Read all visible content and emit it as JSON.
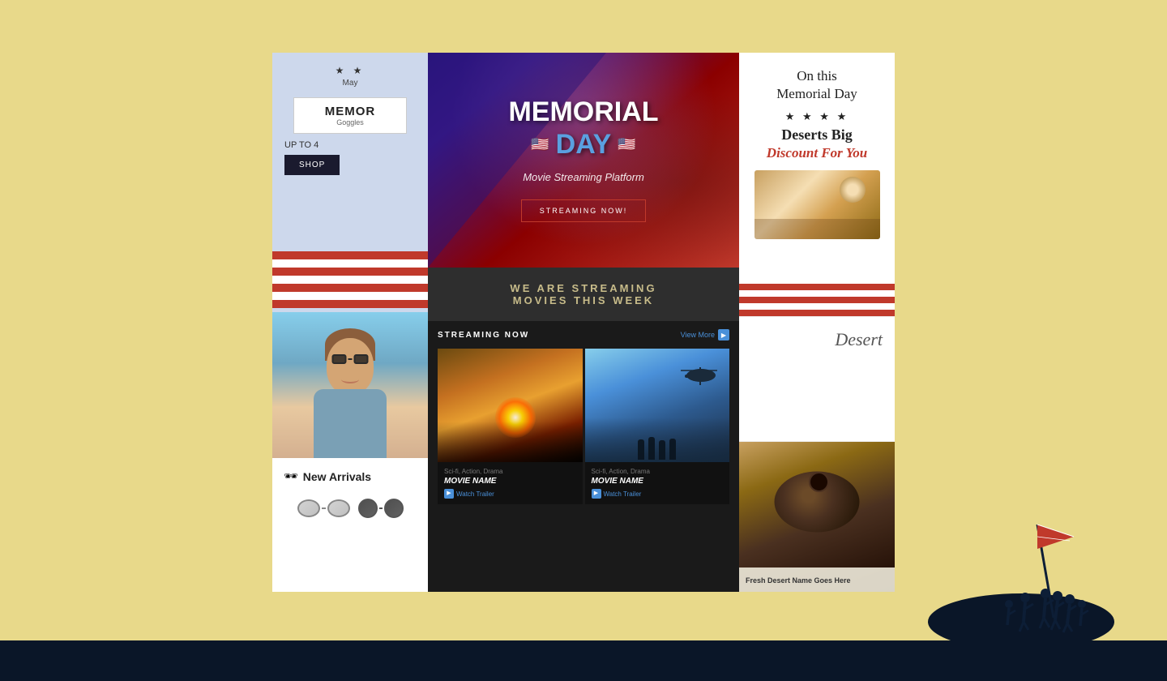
{
  "page": {
    "bg_color": "#e8d98a"
  },
  "left_top": {
    "stars": "★ ★",
    "date": "May",
    "badge_title": "MEMOR",
    "badge_sub": "Goggles",
    "up_to": "UP TO 4",
    "shop_btn": "SHOP"
  },
  "left_arrivals": {
    "icon": "🕶",
    "title": "New Arrivals"
  },
  "hero": {
    "title_line1": "MEMORIAL",
    "title_line2": "DAY",
    "subtitle": "Movie Streaming Platform",
    "cta": "STREAMING NOW!",
    "flag_emoji": "🇺🇸"
  },
  "center_banner": {
    "line1": "WE ARE STREAMING",
    "line2": "MOVIES THIS WEEK"
  },
  "streaming": {
    "label": "STREAMING NOW",
    "view_more": "View More"
  },
  "movie1": {
    "genre": "Sci-fi, Action, Drama",
    "name": "MOVIE NAME",
    "trailer": "Watch Trailer"
  },
  "movie2": {
    "genre": "Sci-fi, Action, Drama",
    "name": "MOVIE NAME",
    "trailer": "Watch Trailer"
  },
  "right_top": {
    "line1": "On this",
    "line2": "Memorial Day",
    "stars": "★ ★ ★ ★",
    "title1": "Deserts Big",
    "title2": "Discount For You"
  },
  "right_mid": {
    "label": "Desert"
  },
  "right_bottom": {
    "name": "Fresh Desert Name Goes Here"
  }
}
